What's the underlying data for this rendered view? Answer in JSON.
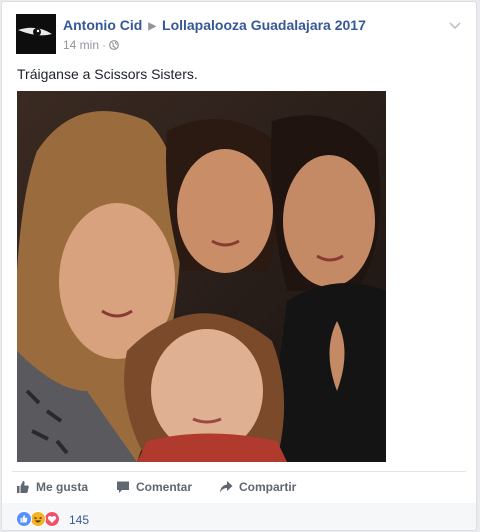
{
  "post": {
    "author": "Antonio Cid",
    "group": "Lollapalooza Guadalajara 2017",
    "time": "14 min",
    "text": "Tráiganse a Scissors Sisters.",
    "privacy_icon": "globe-icon",
    "photo_alt": "photo"
  },
  "actions": {
    "like_label": "Me gusta",
    "comment_label": "Comentar",
    "share_label": "Compartir"
  },
  "reactions": {
    "types": [
      "like",
      "haha",
      "love"
    ],
    "count": "145"
  },
  "colors": {
    "link": "#365899",
    "meta": "#90949c",
    "action_text": "#606770",
    "like": "#5890ff",
    "haha": "#f7b125",
    "love": "#f25268",
    "card_bg": "#ffffff",
    "page_bg": "#e9ebee"
  }
}
